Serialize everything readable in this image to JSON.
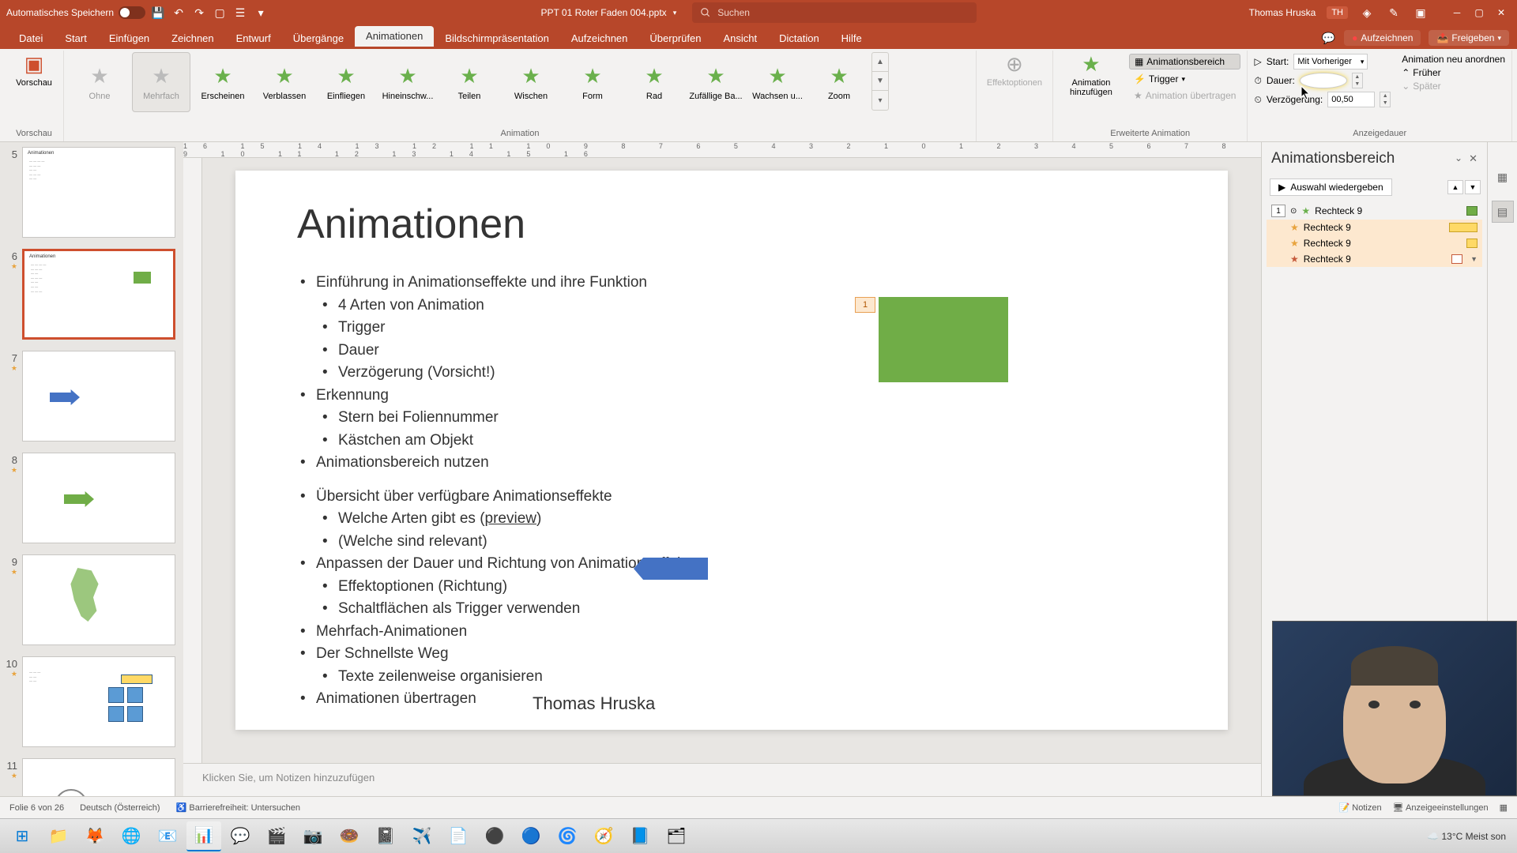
{
  "titlebar": {
    "autosave": "Automatisches Speichern",
    "filename": "PPT 01 Roter Faden 004.pptx",
    "search_placeholder": "Suchen",
    "username": "Thomas Hruska",
    "user_initials": "TH"
  },
  "menu": {
    "tabs": [
      "Datei",
      "Start",
      "Einfügen",
      "Zeichnen",
      "Entwurf",
      "Übergänge",
      "Animationen",
      "Bildschirmpräsentation",
      "Aufzeichnen",
      "Überprüfen",
      "Ansicht",
      "Dictation",
      "Hilfe"
    ],
    "active_index": 6,
    "record": "Aufzeichnen",
    "share": "Freigeben"
  },
  "ribbon": {
    "preview": "Vorschau",
    "preview_group": "Vorschau",
    "gallery": [
      {
        "label": "Ohne",
        "gray": true
      },
      {
        "label": "Mehrfach",
        "selected": true,
        "gray": true
      },
      {
        "label": "Erscheinen"
      },
      {
        "label": "Verblassen"
      },
      {
        "label": "Einfliegen"
      },
      {
        "label": "Hineinschw..."
      },
      {
        "label": "Teilen"
      },
      {
        "label": "Wischen"
      },
      {
        "label": "Form"
      },
      {
        "label": "Rad"
      },
      {
        "label": "Zufällige Ba..."
      },
      {
        "label": "Wachsen u..."
      },
      {
        "label": "Zoom"
      }
    ],
    "animation_group": "Animation",
    "effopt": "Effektoptionen",
    "addanim": "Animation hinzufügen",
    "animpane_btn": "Animationsbereich",
    "trigger_btn": "Trigger",
    "animcopy_btn": "Animation übertragen",
    "ext_group": "Erweiterte Animation",
    "start_label": "Start:",
    "start_value": "Mit Vorheriger",
    "duration_label": "Dauer:",
    "duration_value": "",
    "delay_label": "Verzögerung:",
    "delay_value": "00,50",
    "reorder_title": "Animation neu anordnen",
    "earlier": "Früher",
    "later": "Später",
    "timing_group": "Anzeigedauer"
  },
  "thumbs": [
    {
      "num": "5"
    },
    {
      "num": "6",
      "active": true,
      "star": true
    },
    {
      "num": "7",
      "star": true
    },
    {
      "num": "8",
      "star": true
    },
    {
      "num": "9",
      "star": true
    },
    {
      "num": "10",
      "star": true
    },
    {
      "num": "11",
      "star": true
    }
  ],
  "slide": {
    "title": "Animationen",
    "bullets_l1_0": "Einführung in Animationseffekte und ihre Funktion",
    "bullets_l2_0": "4 Arten von Animation",
    "bullets_l2_1": "Trigger",
    "bullets_l2_2": "Dauer",
    "bullets_l2_3": "Verzögerung (Vorsicht!)",
    "bullets_l1_1": "Erkennung",
    "bullets_l2_4": "Stern bei Foliennummer",
    "bullets_l2_5": "Kästchen am Objekt",
    "bullets_l1_2": "Animationsbereich nutzen",
    "bullets_l1_3": "Übersicht über verfügbare Animationseffekte",
    "bullets_l2_6a": "Welche Arten gibt es (",
    "bullets_l2_6b": "preview",
    "bullets_l2_6c": ")",
    "bullets_l2_7": "(Welche sind relevant)",
    "bullets_l1_4": "Anpassen der Dauer und Richtung von Animationseffekten",
    "bullets_l2_8": "Effektoptionen (Richtung)",
    "bullets_l2_9": "Schaltflächen als Trigger verwenden",
    "bullets_l1_5": "Mehrfach-Animationen",
    "bullets_l1_6": "Der Schnellste Weg",
    "bullets_l2_10": "Texte zeilenweise organisieren",
    "bullets_l1_7": "Animationen übertragen",
    "anim_tag": "1",
    "author": "Thomas Hruska"
  },
  "notes_placeholder": "Klicken Sie, um Notizen hinzuzufügen",
  "animpane": {
    "title": "Animationsbereich",
    "play": "Auswahl wiedergeben",
    "items": [
      {
        "num": "1",
        "name": "Rechteck 9",
        "color": "#70ad47",
        "icon": "★",
        "iconcolor": "#6ab04c"
      },
      {
        "name": "Rechteck 9",
        "color": "#ffd966",
        "icon": "★",
        "iconcolor": "#e8a33d",
        "sel": true,
        "long": true
      },
      {
        "name": "Rechteck 9",
        "color": "#ffd966",
        "icon": "★",
        "iconcolor": "#e8a33d",
        "sel": true
      },
      {
        "name": "Rechteck 9",
        "color": "#ffffff",
        "icon": "★",
        "iconcolor": "#c55a3c",
        "sel": true,
        "dd": true
      }
    ]
  },
  "statusbar": {
    "slide_info": "Folie 6 von 26",
    "language": "Deutsch (Österreich)",
    "accessibility": "Barrierefreiheit: Untersuchen",
    "notes_btn": "Notizen",
    "display_btn": "Anzeigeeinstellungen"
  },
  "taskbar": {
    "weather_temp": "13°C",
    "weather_text": "Meist son"
  },
  "ruler_marks": "16  15  14  13  12  11  10  9  8  7  6  5  4  3  2  1  0  1  2  3  4  5  6  7  8  9  10  11  12  13  14  15  16"
}
